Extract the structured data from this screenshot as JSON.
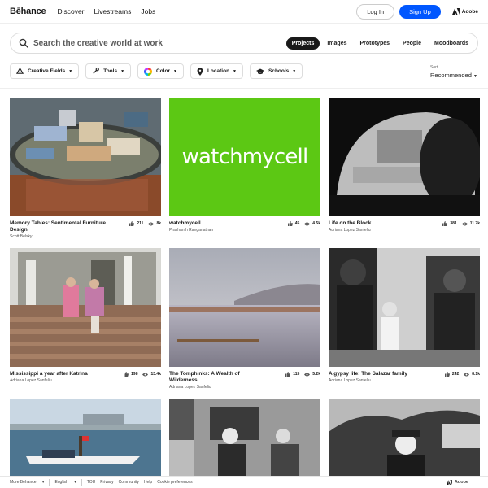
{
  "nav": {
    "logo": "Bēhance",
    "links": [
      "Discover",
      "Livestreams",
      "Jobs"
    ],
    "login": "Log In",
    "signup": "Sign Up",
    "adobe": "Adobe"
  },
  "search": {
    "placeholder": "Search the creative world at work",
    "tabs": [
      "Projects",
      "Images",
      "Prototypes",
      "People",
      "Moodboards"
    ],
    "active_tab": "Projects"
  },
  "filters": [
    "Creative Fields",
    "Tools",
    "Color",
    "Location",
    "Schools"
  ],
  "sort": {
    "label": "Sort",
    "value": "Recommended"
  },
  "projects": [
    {
      "title": "Memory Tables: Sentimental Furniture Design",
      "author": "Scott Belsky",
      "likes": "211",
      "views": "8k"
    },
    {
      "title": "watchmycell",
      "author": "Prashanth Ranganathan",
      "likes": "45",
      "views": "4.5k",
      "thumb_text": "watchmycell"
    },
    {
      "title": "Life on the Block.",
      "author": "Adriana Lopez Sanfeliu",
      "likes": "381",
      "views": "11.7k"
    },
    {
      "title": "Mississippi a year after Katrina",
      "author": "Adriana Lopez Sanfeliu",
      "likes": "198",
      "views": "13.4k"
    },
    {
      "title": "The Tomphinks: A Wealth of Wilderness",
      "author": "Adriana Lopez Sanfeliu",
      "likes": "115",
      "views": "5.2k"
    },
    {
      "title": "A gypsy life: The Salazar family",
      "author": "Adriana Lopez Sanfeliu",
      "likes": "242",
      "views": "8.1k"
    },
    {
      "title": "",
      "author": "",
      "likes": "",
      "views": ""
    },
    {
      "title": "",
      "author": "",
      "likes": "",
      "views": ""
    },
    {
      "title": "",
      "author": "",
      "likes": "",
      "views": ""
    }
  ],
  "footer": {
    "more": "More Behance",
    "lang": "English",
    "links": [
      "TOU",
      "Privacy",
      "Community",
      "Help",
      "Cookie preferences"
    ],
    "adobe": "Adobe"
  },
  "colors": {
    "accent": "#0057ff",
    "watchmycell_bg": "#5cc814"
  }
}
